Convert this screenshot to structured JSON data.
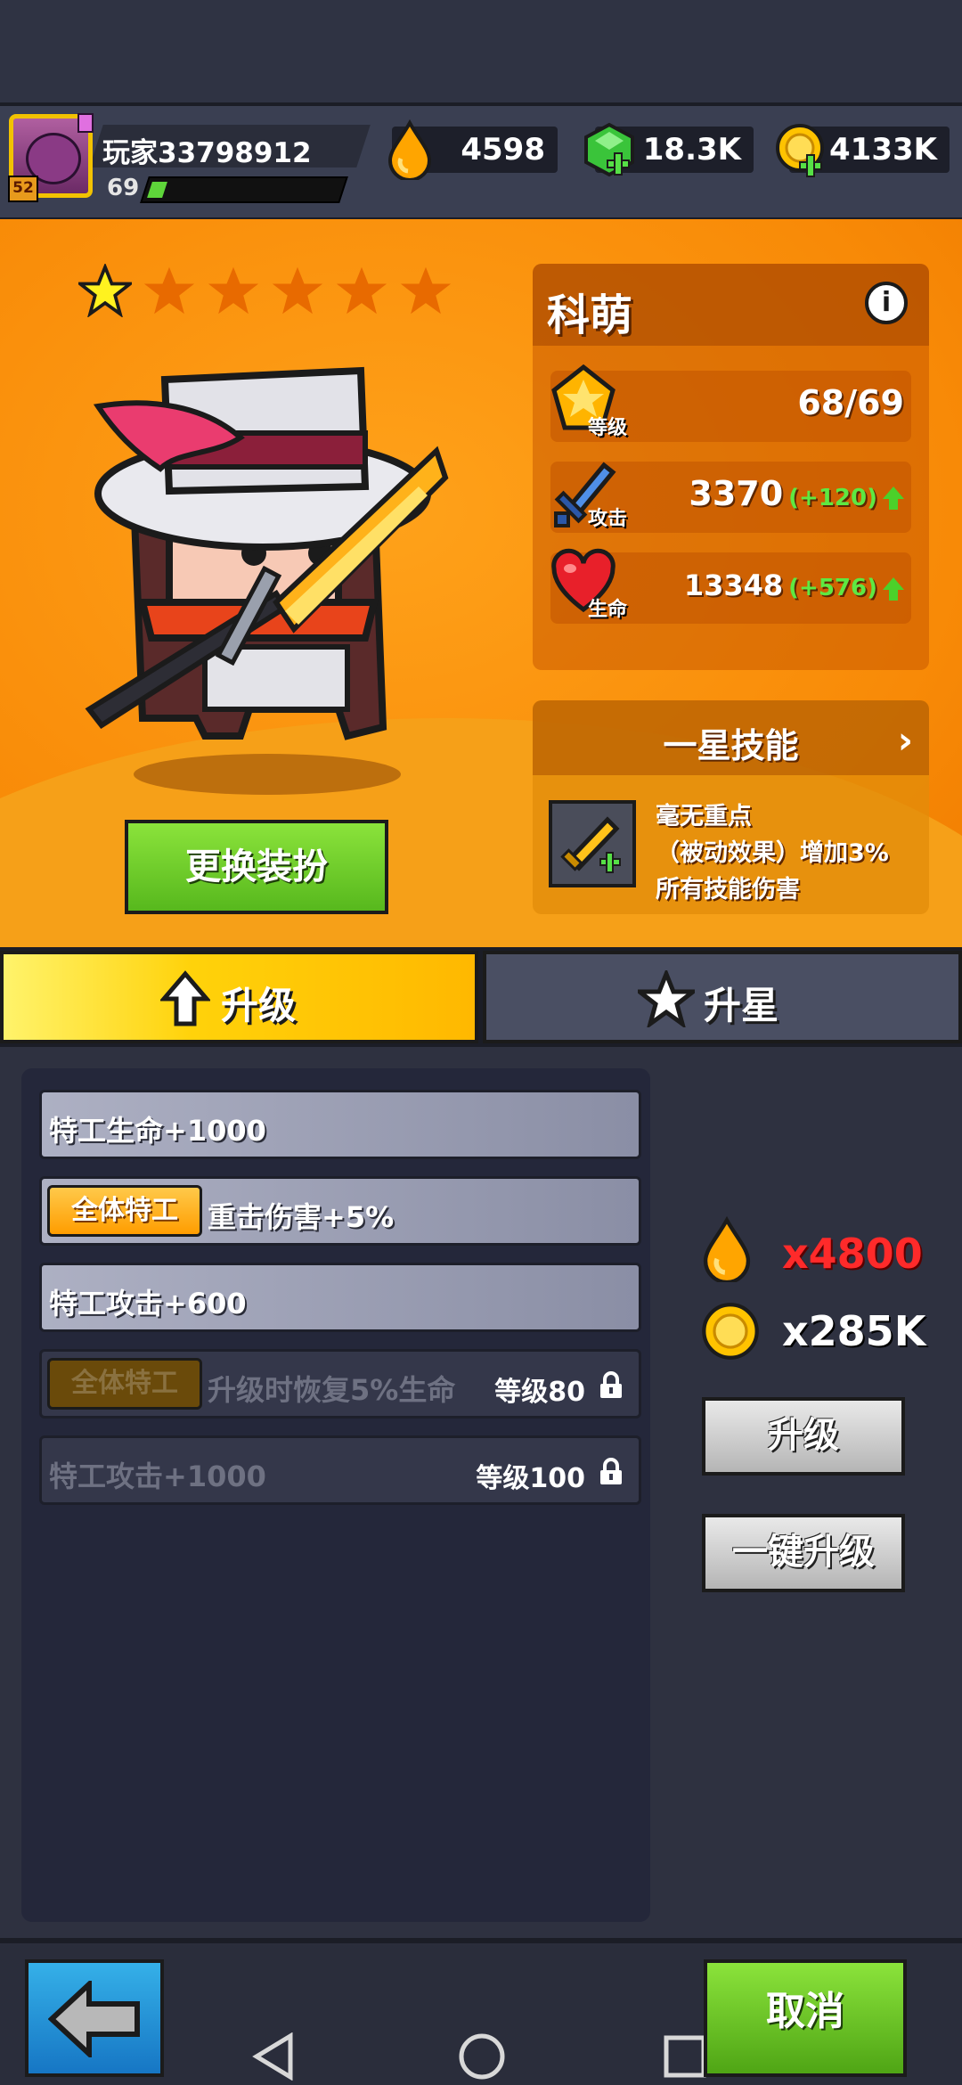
{
  "player": {
    "name": "玩家33798912",
    "level": "69",
    "avatar_badge": "52",
    "xp_fraction": 0.08
  },
  "currencies": [
    {
      "icon": "oil-drop-icon",
      "value": "4598"
    },
    {
      "icon": "green-gem-plus-icon",
      "value": "18.3K"
    },
    {
      "icon": "gold-coin-plus-icon",
      "value": "4133K"
    }
  ],
  "hero": {
    "name": "科萌",
    "stars_filled": 1,
    "stars_total": 6,
    "outfit_button": "更换装扮",
    "stats": [
      {
        "icon": "level-badge-icon",
        "tag": "等级",
        "value": "68/69",
        "bonus": ""
      },
      {
        "icon": "sword-icon",
        "tag": "攻击",
        "value": "3370",
        "bonus": "(+120)"
      },
      {
        "icon": "heart-icon",
        "tag": "生命",
        "value": "13348",
        "bonus": "(+576)"
      }
    ],
    "skill": {
      "title": "一星技能",
      "desc_lines": [
        "毫无重点",
        "（被动效果）增加3%",
        "所有技能伤害"
      ]
    }
  },
  "tabs": {
    "upgrade": "升级",
    "star": "升星",
    "active": "upgrade"
  },
  "upgrade_list": [
    {
      "tag": "",
      "text": "特工生命+1000",
      "req": "",
      "locked": false
    },
    {
      "tag": "全体特工",
      "text": "重击伤害+5%",
      "req": "",
      "locked": false
    },
    {
      "tag": "",
      "text": "特工攻击+600",
      "req": "",
      "locked": false
    },
    {
      "tag": "全体特工",
      "text": "升级时恢复5%生命",
      "req": "等级80",
      "locked": true
    },
    {
      "tag": "",
      "text": "特工攻击+1000",
      "req": "等级100",
      "locked": true
    }
  ],
  "cost": {
    "oil": "x4800",
    "gold": "x285K"
  },
  "buttons": {
    "upgrade": "升级",
    "one_click_upgrade": "一键升级",
    "cancel": "取消"
  },
  "colors": {
    "orange_bg": "#f88a07",
    "cost_red": "#ff2a2a",
    "bonus_green": "#5ee842"
  }
}
